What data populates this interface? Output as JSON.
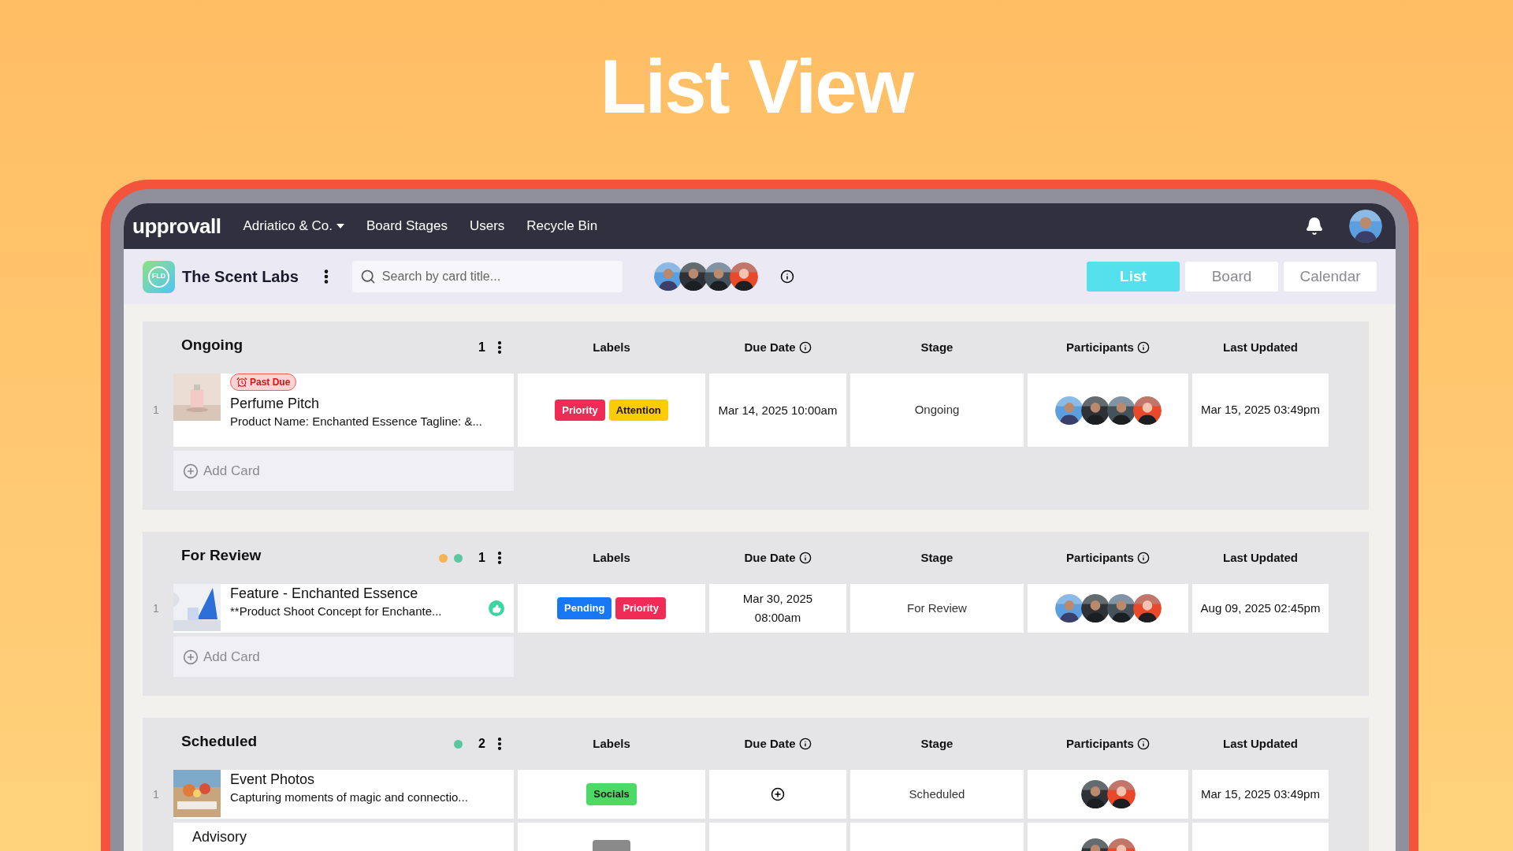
{
  "page_title": "List View",
  "navbar": {
    "logo": "upprovall",
    "menu": [
      {
        "label": "Adriatico & Co.",
        "dropdown": true
      },
      {
        "label": "Board Stages",
        "dropdown": false
      },
      {
        "label": "Users",
        "dropdown": false
      },
      {
        "label": "Recycle Bin",
        "dropdown": false
      }
    ]
  },
  "board": {
    "badge": "FLD",
    "name": "The Scent Labs",
    "search": {
      "placeholder": "Search by card title..."
    },
    "members": [
      {
        "kind": "picture"
      },
      {
        "kind": "picture"
      },
      {
        "kind": "picture"
      },
      {
        "kind": "picture"
      }
    ],
    "views": [
      {
        "label": "List",
        "selected": true
      },
      {
        "label": "Board",
        "selected": false
      },
      {
        "label": "Calendar",
        "selected": false
      }
    ]
  },
  "groups": [
    {
      "name": "Ongoing",
      "count": "1",
      "columns": [
        {
          "label": "Labels",
          "kind": "plain"
        },
        {
          "label": "Due Date",
          "kind": "info"
        },
        {
          "label": "Stage",
          "kind": "plain"
        },
        {
          "label": "Participants",
          "kind": "info"
        },
        {
          "label": "Last Updated",
          "kind": "plain"
        }
      ],
      "cards": [
        {
          "index": "1",
          "thumbnail": {
            "kind": "picture"
          },
          "past_due": "Past Due",
          "title": "Perfume Pitch",
          "description": "Product Name: Enchanted Essence Tagline: &...",
          "approved": false,
          "labels": [
            {
              "text": "Priority",
              "color": "#f02c56"
            },
            {
              "text": "Attention",
              "color": "#fccb00"
            }
          ],
          "due_date": "Mar 14, 2025 10:00am",
          "stage": "Ongoing",
          "participants": [
            {
              "kind": "picture"
            },
            {
              "kind": "picture"
            },
            {
              "kind": "picture"
            },
            {
              "kind": "picture"
            }
          ],
          "last_updated": "Mar 15, 2025 03:49pm"
        }
      ],
      "add_card": "Add Card"
    },
    {
      "name": "For Review",
      "status_dots": [
        {
          "color": "#f5b351"
        },
        {
          "color": "#5cc6a0"
        }
      ],
      "count": "1",
      "columns": [
        {
          "label": "Labels",
          "kind": "plain"
        },
        {
          "label": "Due Date",
          "kind": "info"
        },
        {
          "label": "Stage",
          "kind": "plain"
        },
        {
          "label": "Participants",
          "kind": "info"
        },
        {
          "label": "Last Updated",
          "kind": "plain"
        }
      ],
      "cards": [
        {
          "index": "1",
          "thumbnail": {
            "kind": "picture"
          },
          "title": "Feature - Enchanted Essence",
          "description": "**Product Shoot Concept for Enchante...",
          "approved": true,
          "labels": [
            {
              "text": "Pending",
              "color": "#1877f2"
            },
            {
              "text": "Priority",
              "color": "#f02c56"
            }
          ],
          "due_date": "Mar 30, 2025 08:00am",
          "stage": "For Review",
          "participants": [
            {
              "kind": "picture"
            },
            {
              "kind": "picture"
            },
            {
              "kind": "picture"
            },
            {
              "kind": "picture"
            }
          ],
          "last_updated": "Aug 09, 2025 02:45pm"
        }
      ],
      "add_card": "Add Card"
    },
    {
      "name": "Scheduled",
      "status_dots": [
        {
          "color": "#5cc6a0"
        }
      ],
      "count": "2",
      "columns": [
        {
          "label": "Labels",
          "kind": "plain"
        },
        {
          "label": "Due Date",
          "kind": "info"
        },
        {
          "label": "Stage",
          "kind": "plain"
        },
        {
          "label": "Participants",
          "kind": "info"
        },
        {
          "label": "Last Updated",
          "kind": "plain"
        }
      ],
      "cards": [
        {
          "index": "1",
          "thumbnail": {
            "kind": "picture"
          },
          "title": "Event Photos",
          "description": "Capturing moments of magic and connectio...",
          "approved": false,
          "labels": [
            {
              "text": "Socials",
              "color": "#4cd964"
            }
          ],
          "stage": "Scheduled",
          "participants": [
            {
              "kind": "picture"
            },
            {
              "kind": "picture"
            }
          ],
          "last_updated": "Mar 15, 2025 03:49pm"
        },
        {
          "title": "Advisory",
          "approved": false,
          "labels": [
            {
              "color": "#8a8a8a"
            }
          ],
          "participants": [
            {
              "kind": "picture"
            },
            {
              "kind": "picture"
            }
          ]
        }
      ]
    }
  ]
}
